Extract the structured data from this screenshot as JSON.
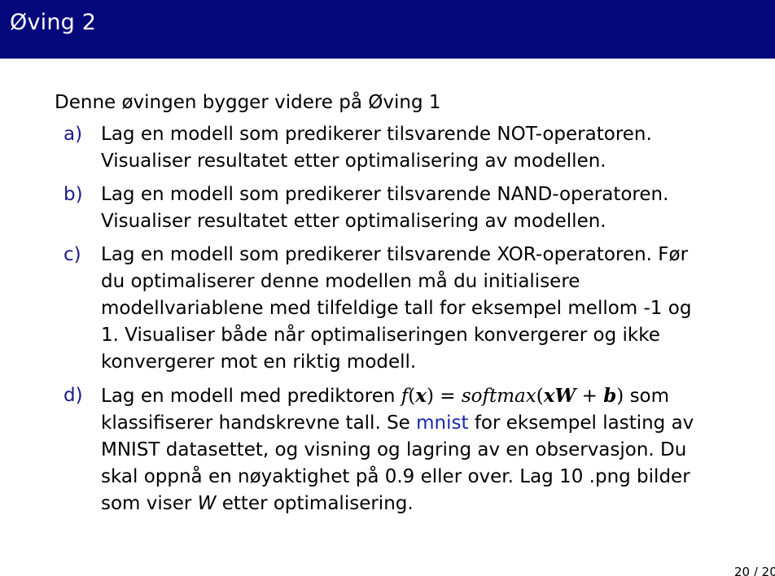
{
  "slide": {
    "title": "Øving 2",
    "intro": "Denne øvingen bygger videre på Øving 1",
    "page_number": "20 / 20"
  },
  "tasks": [
    {
      "marker": "a)",
      "lines": [
        "Lag en modell som predikerer tilsvarende NOT-operatoren.",
        "Visualiser resultatet etter optimalisering av modellen."
      ]
    },
    {
      "marker": "b)",
      "lines": [
        "Lag en modell som predikerer tilsvarende NAND-operatoren.",
        "Visualiser resultatet etter optimalisering av modellen."
      ]
    },
    {
      "marker": "c)",
      "lines": [
        "Lag en modell som predikerer tilsvarende XOR-operatoren. Før",
        "du optimaliserer denne modellen må du initialisere",
        "modellvariablene med tilfeldige tall for eksempel mellom -1 og",
        "1. Visualiser både når optimaliseringen konvergerer og ikke",
        "konvergerer mot en riktig modell."
      ]
    },
    {
      "marker": "d)",
      "line1_prefix": "Lag en modell med prediktoren ",
      "formula": {
        "f": "f",
        "open": "(",
        "x": "x",
        "close_eq": ") = ",
        "softmax": "softmax",
        "open2": "(",
        "xW_x": "x",
        "xW_W": "W",
        "plus": " + ",
        "b": "b",
        "close2": ")"
      },
      "line1_suffix": " som",
      "line2_prefix": "klassifiserer handskrevne tall. Se ",
      "link_text": "mnist",
      "line2_suffix": " for eksempel lasting av",
      "line3": "MNIST datasettet, og visning og lagring av en observasjon. Du",
      "line4": "skal oppnå en nøyaktighet på 0.9 eller over. Lag 10 .png bilder",
      "line5_prefix": "som viser ",
      "line5_var": "W",
      "line5_suffix": " etter optimalisering."
    }
  ],
  "colors": {
    "title_bar": "#05087a",
    "marker": "#1a1a8c",
    "link": "#1a2aa8"
  }
}
